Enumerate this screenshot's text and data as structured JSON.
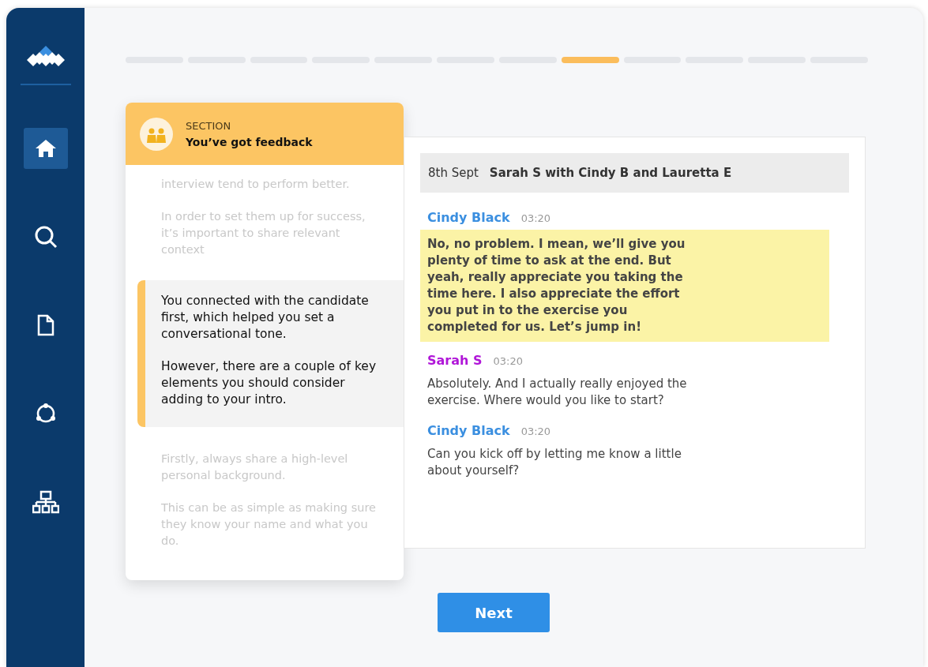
{
  "sidebar": {
    "items": [
      {
        "kind": "home",
        "selected": true
      },
      {
        "kind": "search",
        "selected": false
      },
      {
        "kind": "document",
        "selected": false
      },
      {
        "kind": "cycle",
        "selected": false
      },
      {
        "kind": "hierarchy",
        "selected": false
      }
    ]
  },
  "progress_steps": [
    {
      "selected": false
    },
    {
      "selected": false
    },
    {
      "selected": false
    },
    {
      "selected": false
    },
    {
      "selected": false
    },
    {
      "selected": false
    },
    {
      "selected": false
    },
    {
      "selected": true
    },
    {
      "selected": false
    },
    {
      "selected": false
    },
    {
      "selected": false
    },
    {
      "selected": false
    }
  ],
  "feedback": {
    "label": "SECTION",
    "title": "You’ve got feedback",
    "blocks": [
      {
        "kind": "faded",
        "paragraphs": [
          "interview tend to perform better.",
          "In order to set them up for success, it’s important to share relevant context"
        ]
      },
      {
        "kind": "focus",
        "paragraphs": [
          "You connected with the candidate first, which helped you set a conversational tone.",
          "However, there are a couple of key elements you should consider adding to your intro."
        ]
      },
      {
        "kind": "faded",
        "paragraphs": [
          "Firstly, always share a high-level personal background.",
          "This can be as simple as making sure they know your name and what you do."
        ]
      }
    ]
  },
  "transcript": {
    "date": "8th Sept",
    "title": "Sarah S with Cindy B and Lauretta E",
    "messages": [
      {
        "speaker": "Cindy Black",
        "color": "#3b8fe0",
        "time": "03:20",
        "highlighted": true,
        "text": "No, no problem. I mean, we’ll give you plenty of time to ask at the end. But yeah, really appreciate you taking the time here. I also appreciate the effort you put in to the exercise you completed for us. Let’s jump in!"
      },
      {
        "speaker": "Sarah S",
        "color": "#b016d8",
        "time": "03:20",
        "highlighted": false,
        "text": "Absolutely. And I actually really enjoyed the exercise. Where would you like to start?"
      },
      {
        "speaker": "Cindy Black",
        "color": "#3b8fe0",
        "time": "03:20",
        "highlighted": false,
        "text": "Can you kick off by letting me know a little about yourself?"
      }
    ]
  },
  "next_button": "Next"
}
